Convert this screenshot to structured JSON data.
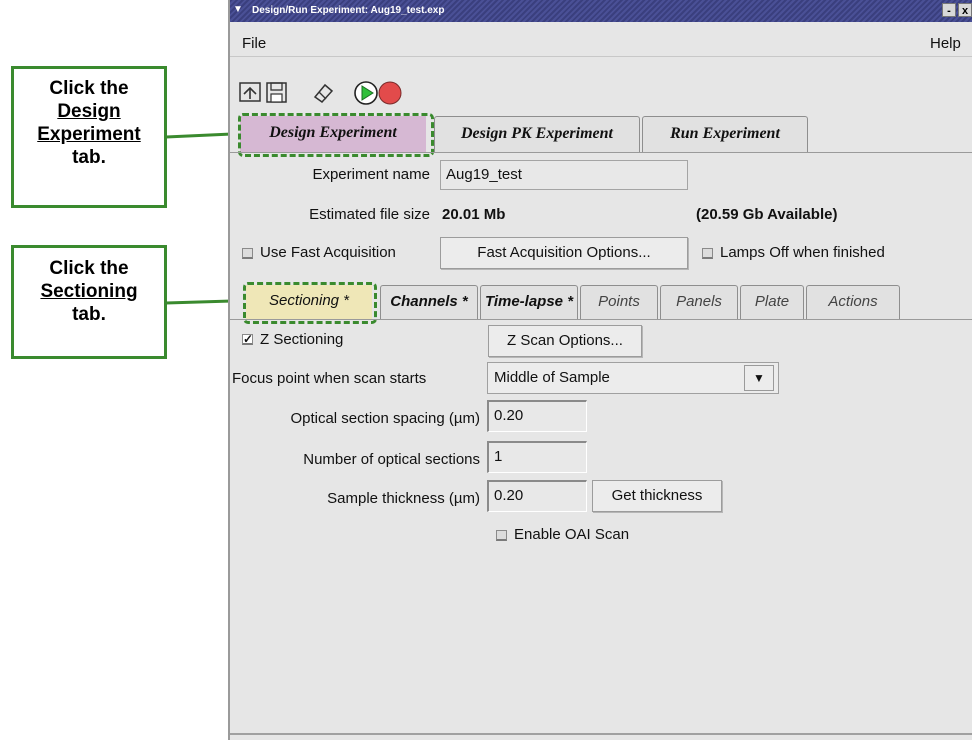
{
  "callouts": {
    "design": {
      "line1": "Click the",
      "line2": "Design",
      "line3": "Experiment",
      "line4": "tab."
    },
    "sectioning": {
      "line1": "Click the",
      "line2": "Sectioning",
      "line3": "tab."
    }
  },
  "window": {
    "title": "Design/Run Experiment: Aug19_test.exp",
    "title_buttons": [
      "-",
      "x"
    ]
  },
  "menu": {
    "file": "File",
    "help": "Help"
  },
  "toolbar": {
    "icons": [
      "reload-icon",
      "save-icon",
      "eraser-icon",
      "play-icon",
      "stop-icon"
    ]
  },
  "top_tabs": [
    {
      "label": "Design Experiment",
      "active": true
    },
    {
      "label": "Design PK Experiment",
      "active": false
    },
    {
      "label": "Run Experiment",
      "active": false
    }
  ],
  "experiment": {
    "name_label": "Experiment name",
    "name_value": "Aug19_test",
    "file_size_label": "Estimated file size",
    "file_size_value": "20.01 Mb",
    "available": "(20.59 Gb Available)",
    "fast_acq_label": "Use Fast Acquisition",
    "fast_acq_button": "Fast Acquisition Options...",
    "lamps_off_label": "Lamps Off when finished"
  },
  "section_tabs": [
    {
      "label": "Sectioning *",
      "active": true
    },
    {
      "label": "Channels *",
      "active": false
    },
    {
      "label": "Time-lapse *",
      "active": false
    },
    {
      "label": "Points",
      "active": false
    },
    {
      "label": "Panels",
      "active": false
    },
    {
      "label": "Plate",
      "active": false
    },
    {
      "label": "Actions",
      "active": false
    }
  ],
  "sectioning": {
    "z_sectioning_label": "Z Sectioning",
    "z_sectioning_checked": true,
    "z_scan_button": "Z Scan Options...",
    "focus_label": "Focus point when scan starts",
    "focus_value": "Middle of Sample",
    "spacing_label": "Optical section spacing (µm)",
    "spacing_value": "0.20",
    "num_sections_label": "Number of optical sections",
    "num_sections_value": "1",
    "thickness_label": "Sample thickness (µm)",
    "thickness_value": "0.20",
    "get_thickness_button": "Get thickness",
    "oai_label": "Enable OAI Scan"
  },
  "colors": {
    "callout_border": "#3a8a2e",
    "active_design_tab": "#d6b8d3",
    "active_section_tab": "#efe7b7",
    "play_green": "#2fbf3a",
    "stop_red": "#e24b4b"
  }
}
